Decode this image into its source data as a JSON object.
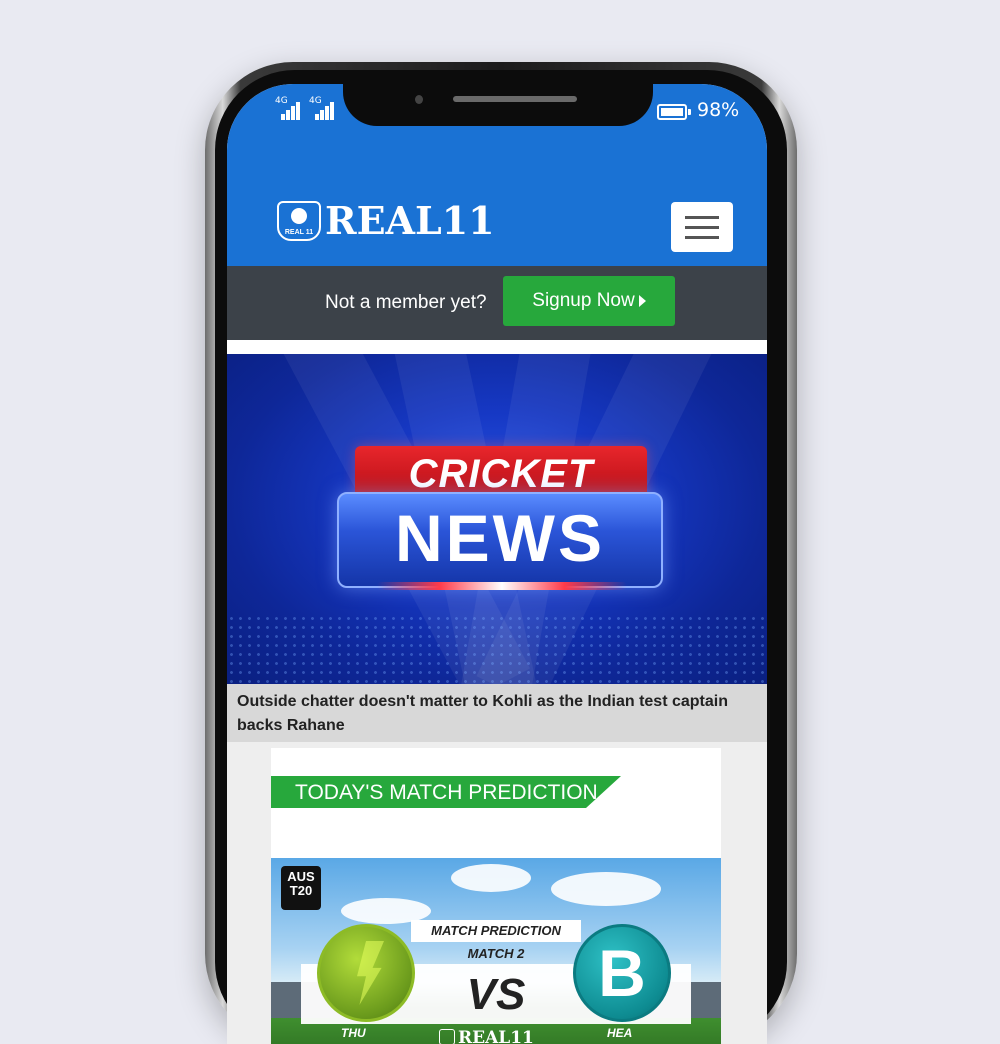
{
  "status_bar": {
    "sim1_label": "4G",
    "sim2_label": "4G",
    "battery_percent": "98%",
    "battery_level": 0.98
  },
  "header": {
    "logo_text": "REAL11",
    "logo_badge_text": "REAL 11",
    "menu_icon": "hamburger-menu-icon",
    "brand_color": "#1a72d4"
  },
  "signup": {
    "prompt": "Not a member yet?",
    "button_label": "Signup Now",
    "button_color": "#27a83c"
  },
  "banner": {
    "line1": "CRICKET",
    "line2": "NEWS"
  },
  "article": {
    "headline": "Outside chatter doesn't matter to Kohli as the Indian test captain backs Rahane"
  },
  "prediction_card": {
    "tag": "TODAY'S MATCH PREDICTION",
    "league_badge": "AUS T20",
    "title": "MATCH PREDICTION",
    "match": "MATCH 2",
    "vs": "VS",
    "team_left": "THU",
    "team_right": "HEA",
    "team_right_logo_letter": "B",
    "footer_logo": "REAL11"
  }
}
